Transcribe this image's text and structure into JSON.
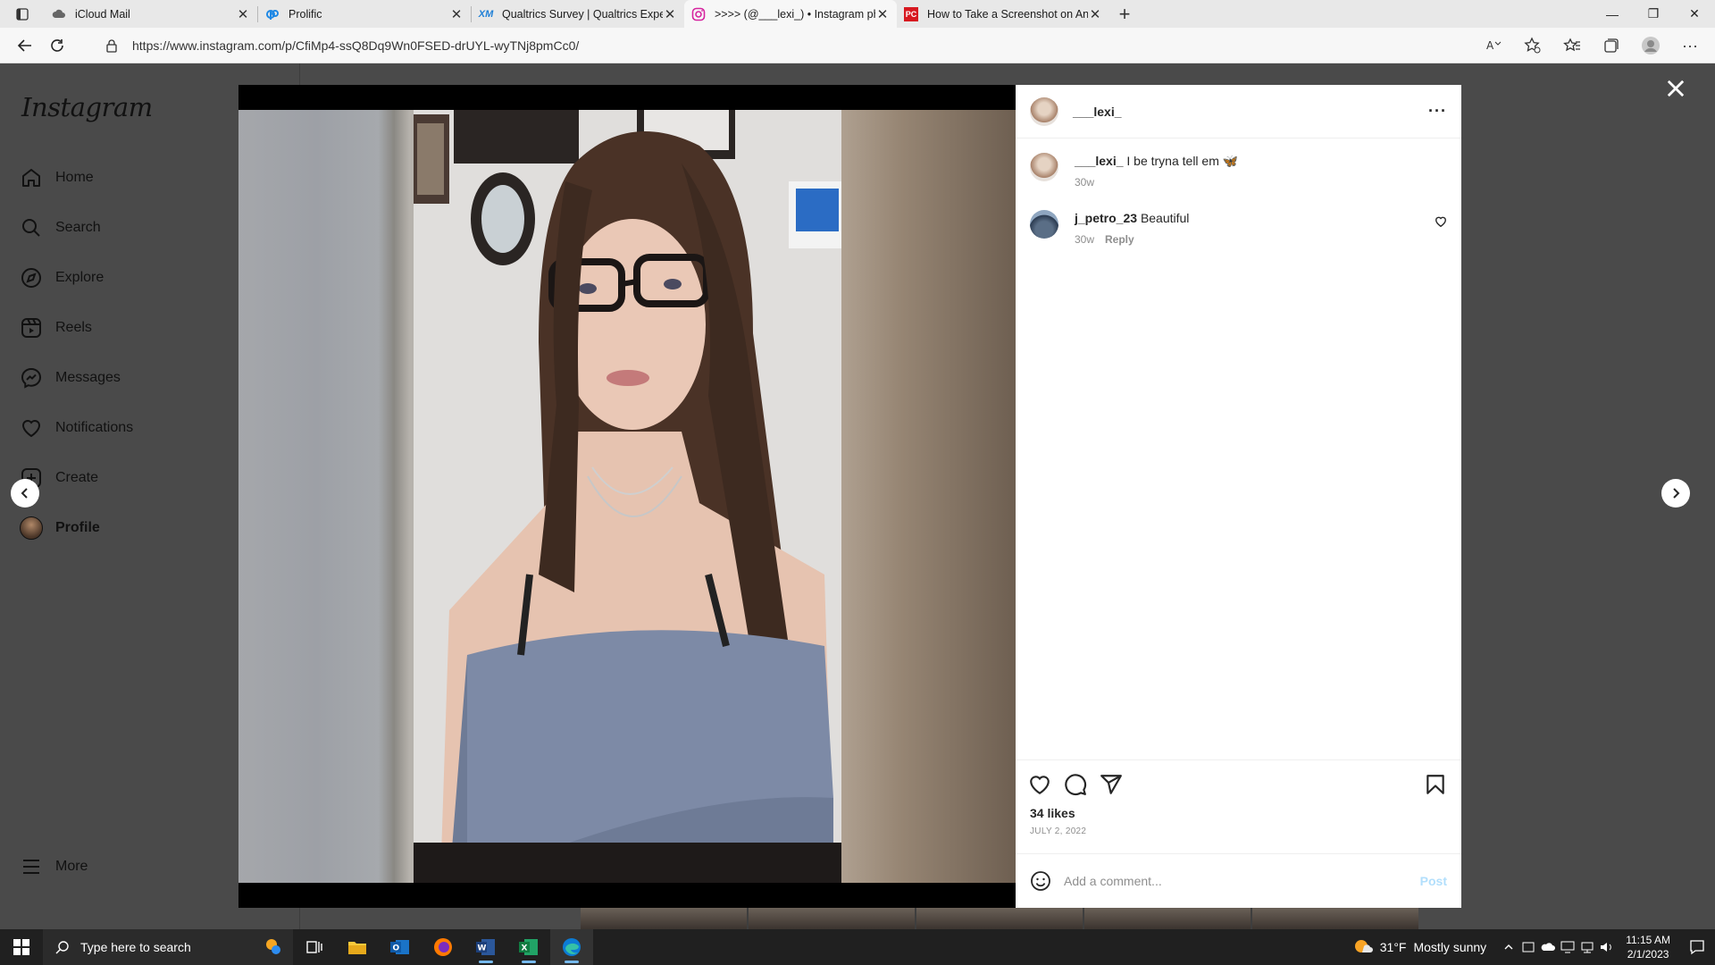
{
  "browser": {
    "tabs": [
      {
        "title": "iCloud Mail",
        "icon": "icloud-icon",
        "active": false
      },
      {
        "title": "Prolific",
        "icon": "prolific-icon",
        "active": false
      },
      {
        "title": "Qualtrics Survey | Qualtrics Experience Management",
        "icon": "qualtrics-icon",
        "active": false
      },
      {
        "title": ">>>> (@___lexi_) • Instagram photos and videos",
        "icon": "instagram-icon",
        "active": true
      },
      {
        "title": "How to Take a Screenshot on Any Device",
        "icon": "pcmag-icon",
        "active": false
      }
    ],
    "url": "https://www.instagram.com/p/CfiMp4-ssQ8Dq9Wn0FSED-drUYL-wyTNj8pmCc0/"
  },
  "sidebar": {
    "logo": "Instagram",
    "items": [
      {
        "label": "Home",
        "icon": "home-icon"
      },
      {
        "label": "Search",
        "icon": "search-icon"
      },
      {
        "label": "Explore",
        "icon": "compass-icon"
      },
      {
        "label": "Reels",
        "icon": "reels-icon"
      },
      {
        "label": "Messages",
        "icon": "messenger-icon"
      },
      {
        "label": "Notifications",
        "icon": "heart-icon"
      },
      {
        "label": "Create",
        "icon": "plus-square-icon"
      },
      {
        "label": "Profile",
        "icon": "avatar"
      }
    ],
    "more": "More"
  },
  "post": {
    "username": "___lexi_",
    "caption_user": "___lexi_",
    "caption": "I be tryna tell em 🦋",
    "caption_age": "30w",
    "comments": [
      {
        "user": "j_petro_23",
        "text": "Beautiful",
        "age": "30w",
        "reply": "Reply"
      }
    ],
    "likes": "34 likes",
    "date": "JULY 2, 2022",
    "comment_placeholder": "Add a comment...",
    "post_label": "Post"
  },
  "taskbar": {
    "search_placeholder": "Type here to search",
    "weather_temp": "31°F",
    "weather_desc": "Mostly sunny",
    "time": "11:15 AM",
    "date": "2/1/2023"
  },
  "colors": {
    "overlay": "#4a4a4a",
    "post_link": "#b2dffc",
    "taskbar": "#202020"
  }
}
